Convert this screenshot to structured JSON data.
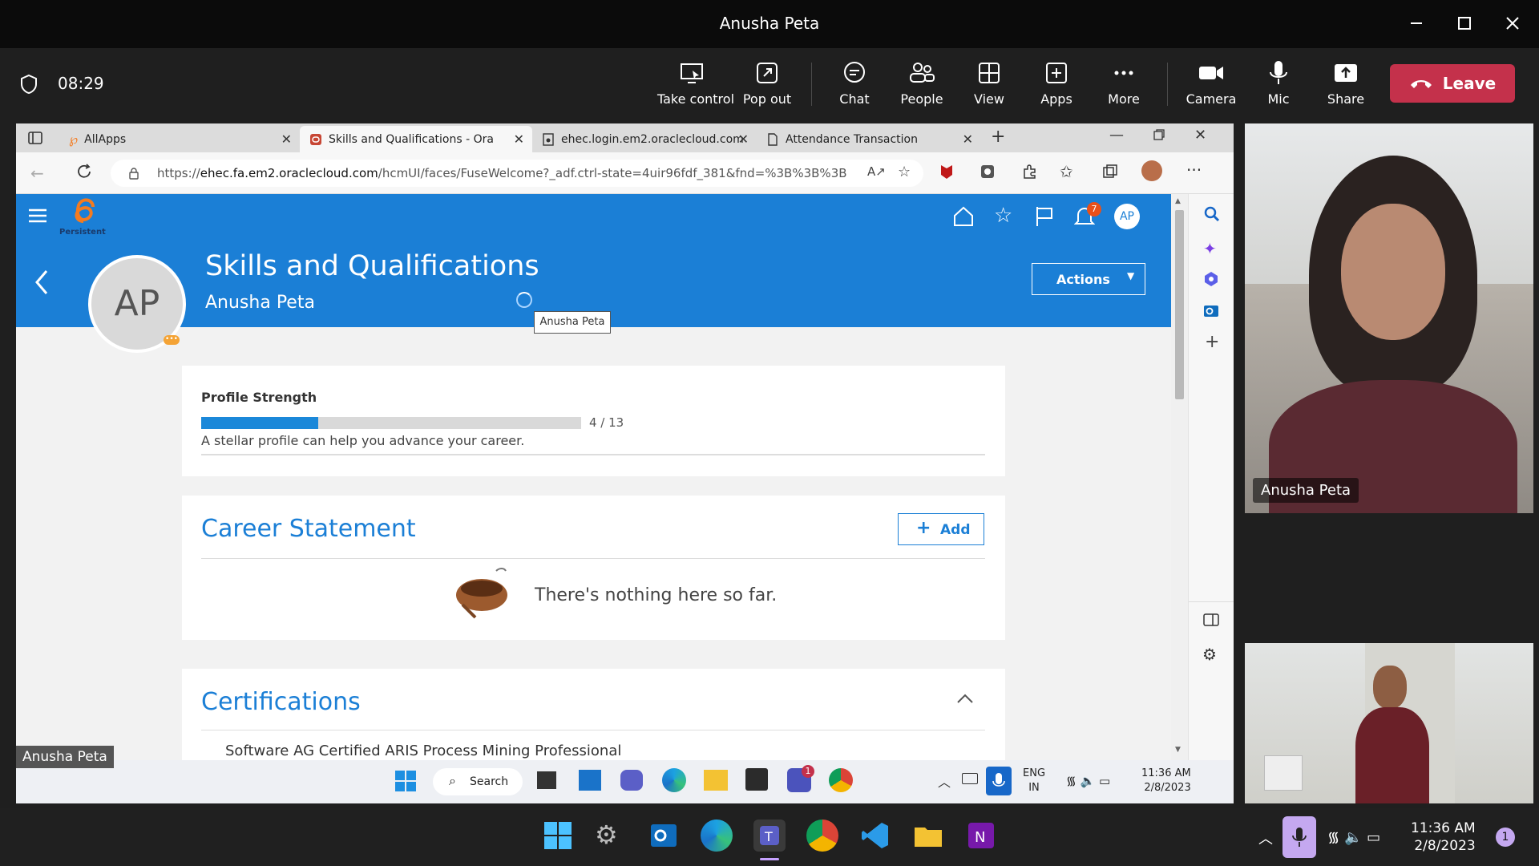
{
  "teams": {
    "window_title": "Anusha Peta",
    "call_timer": "08:29",
    "toolbar": [
      {
        "key": "take-control",
        "label": "Take control",
        "icon": "take-control-icon"
      },
      {
        "key": "pop-out",
        "label": "Pop out",
        "icon": "pop-out-icon"
      },
      {
        "key": "chat",
        "label": "Chat",
        "icon": "chat-icon"
      },
      {
        "key": "people",
        "label": "People",
        "icon": "people-icon"
      },
      {
        "key": "view",
        "label": "View",
        "icon": "view-icon"
      },
      {
        "key": "apps",
        "label": "Apps",
        "icon": "apps-icon"
      },
      {
        "key": "more",
        "label": "More",
        "icon": "more-icon"
      },
      {
        "key": "camera",
        "label": "Camera",
        "icon": "camera-icon"
      },
      {
        "key": "mic",
        "label": "Mic",
        "icon": "mic-icon"
      },
      {
        "key": "share",
        "label": "Share",
        "icon": "share-icon"
      }
    ],
    "leave_label": "Leave",
    "leave_color": "#c4314b"
  },
  "browser": {
    "tabs": [
      {
        "title": "AllApps",
        "active": false
      },
      {
        "title": "Skills and Qualifications - Oracle",
        "active": true
      },
      {
        "title": "ehec.login.em2.oraclecloud.com",
        "active": false
      },
      {
        "title": "Attendance Transaction",
        "active": false
      }
    ],
    "url_prefix": "https://",
    "url_host": "ehec.fa.em2.oraclecloud.com",
    "url_rest": "/hcmUI/faces/FuseWelcome?_adf.ctrl-state=4uir96fdf_381&fnd=%3B%3B%3B%..."
  },
  "oracle": {
    "brand_label": "Persistent",
    "notification_count": "7",
    "user_initials": "AP",
    "page_title": "Skills and Qualifications",
    "person_name": "Anusha Peta",
    "tooltip": "Anusha Peta",
    "actions_label": "Actions",
    "accent_color": "#1b7fd6",
    "profile_strength": {
      "title": "Profile Strength",
      "current": 4,
      "total": 13,
      "ratio_text": "4 / 13",
      "hint": "A stellar profile can help you advance your career."
    },
    "career_statement": {
      "title": "Career Statement",
      "add_label": "Add",
      "empty_text": "There's nothing here so far."
    },
    "certifications": {
      "title": "Certifications",
      "items": [
        "Software AG Certified ARIS Process Mining Professional"
      ]
    }
  },
  "remote_taskbar": {
    "presenter_name": "Anusha Peta",
    "search_label": "Search",
    "lang_line1": "ENG",
    "lang_line2": "IN",
    "time": "11:36 AM",
    "date": "2/8/2023",
    "teams_badge": "1"
  },
  "participants": [
    {
      "name": "Anusha Peta"
    }
  ],
  "local_taskbar": {
    "time": "11:36 AM",
    "date": "2/8/2023",
    "notification_count": "1"
  }
}
